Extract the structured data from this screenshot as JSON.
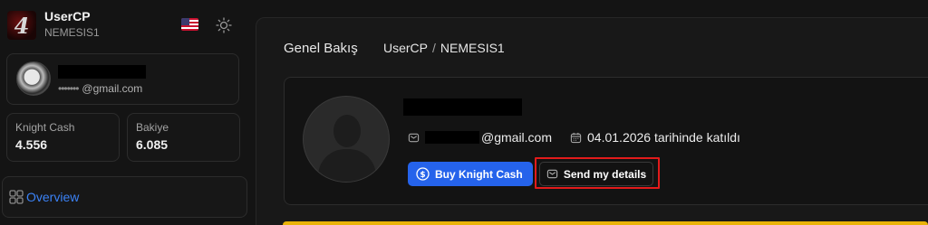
{
  "brand": {
    "title": "UserCP",
    "subtitle": "NEMESIS1",
    "logo_glyph": "4"
  },
  "header_icons": {
    "flag": "us-flag-icon",
    "theme": "sun-icon"
  },
  "user_card": {
    "email_masked": "•••••••",
    "email_domain": "@gmail.com"
  },
  "stats": [
    {
      "label": "Knight Cash",
      "value": "4.556"
    },
    {
      "label": "Bakiye",
      "value": "6.085"
    }
  ],
  "nav": {
    "overview_label": "Overview"
  },
  "main": {
    "title": "Genel Bakış",
    "breadcrumb": {
      "root": "UserCP",
      "sep": "/",
      "current": "NEMESIS1"
    }
  },
  "profile": {
    "email_domain": "@gmail.com",
    "joined": "04.01.2026 tarihinde katıldı",
    "buy_button": "Buy Knight Cash",
    "send_button": "Send my details"
  },
  "colors": {
    "accent": "#2563eb",
    "link": "#3b82f6",
    "highlight": "#e21b1b",
    "warning": "#eab308"
  }
}
